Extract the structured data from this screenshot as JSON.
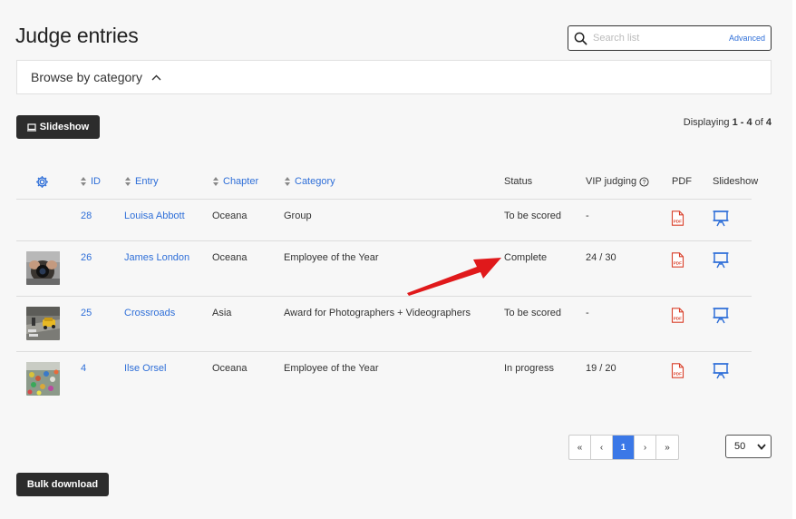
{
  "page": {
    "title": "Judge entries"
  },
  "search": {
    "placeholder": "Search list",
    "advanced_label": "Advanced"
  },
  "browse": {
    "label": "Browse by category"
  },
  "toolbar": {
    "slideshow_label": "Slideshow",
    "bulk_download_label": "Bulk download"
  },
  "display": {
    "prefix": "Displaying ",
    "range": "1 - 4",
    "of_word": " of ",
    "total": "4"
  },
  "table": {
    "headers": {
      "id": "ID",
      "entry": "Entry",
      "chapter": "Chapter",
      "category": "Category",
      "status": "Status",
      "vip": "VIP judging",
      "pdf": "PDF",
      "slideshow": "Slideshow"
    },
    "rows": [
      {
        "id": "28",
        "entry": "Louisa Abbott",
        "chapter": "Oceana",
        "category": "Group",
        "status": "To be scored",
        "vip": "-",
        "thumb": ""
      },
      {
        "id": "26",
        "entry": "James London",
        "chapter": "Oceana",
        "category": "Employee of the Year",
        "status": "Complete",
        "vip": "24 / 30",
        "thumb": "camera-photo"
      },
      {
        "id": "25",
        "entry": "Crossroads",
        "chapter": "Asia",
        "category": "Award for Photographers + Videographers",
        "status": "To be scored",
        "vip": "-",
        "thumb": "taxi-photo"
      },
      {
        "id": "4",
        "entry": "Ilse Orsel",
        "chapter": "Oceana",
        "category": "Employee of the Year",
        "status": "In progress",
        "vip": "19 / 20",
        "thumb": "market-photo"
      }
    ]
  },
  "pagination": {
    "first": "«",
    "prev": "‹",
    "current": "1",
    "next": "›",
    "last": "»",
    "per_page": "50"
  },
  "colors": {
    "link": "#2f6fd8",
    "pdf": "#d9402b",
    "arrow": "#e0191b",
    "active_page": "#3b78e7",
    "button_dark": "#2c2c2c"
  },
  "icons": [
    "search-icon",
    "chevron-up-icon",
    "monitor-icon",
    "gear-icon",
    "sort-icon",
    "help-circle-icon",
    "pdf-file-icon",
    "presentation-board-icon",
    "chevron-down-icon",
    "red-arrow-annotation"
  ]
}
